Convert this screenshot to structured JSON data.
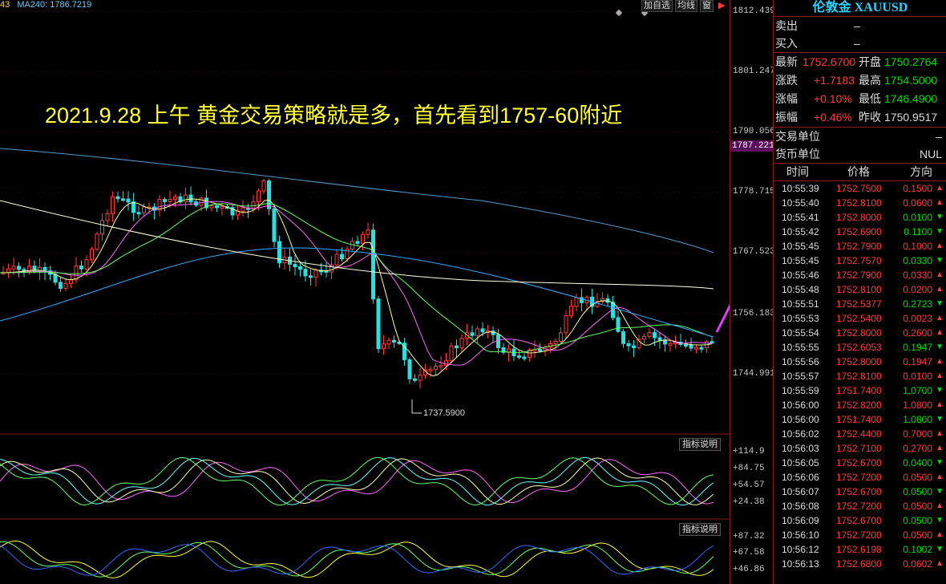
{
  "chart_header": {
    "ma_prefix": "43",
    "ma_label": "MA240: 1786.7219",
    "buttons": [
      "加自选",
      "均线",
      "窗"
    ]
  },
  "annotation_text": "2021.9.28 上午 黄金交易策略就是多，首先看到1757-60附近",
  "low_marker": "1737.5900",
  "price_axis": [
    "1812.439",
    "1801.247",
    "1790.056",
    "1787.221",
    "1778.715",
    "1767.523",
    "1756.183",
    "1744.991"
  ],
  "indicator1": {
    "button": "指标说明",
    "ticks": [
      "+114.9",
      "+84.75",
      "+54.57",
      "+24.38"
    ]
  },
  "indicator2": {
    "button": "指标说明",
    "ticks": [
      "+87.32",
      "+67.58",
      "+46.86"
    ]
  },
  "quote": {
    "title": "伦敦金 XAUUSD",
    "sell_label": "卖出",
    "sell_value": "–",
    "buy_label": "买入",
    "buy_value": "–",
    "stats": [
      {
        "l1": "最新",
        "v1": "1752.6700",
        "l2": "开盘",
        "v2": "1750.2764"
      },
      {
        "l1": "涨跌",
        "v1": "+1.7183",
        "l2": "最高",
        "v2": "1754.5000"
      },
      {
        "l1": "涨幅",
        "v1": "+0.10%",
        "l2": "最低",
        "v2": "1746.4900"
      },
      {
        "l1": "振幅",
        "v1": "+0.46%",
        "l2": "昨收",
        "v2": "1750.9517"
      }
    ],
    "trade_unit_label": "交易单位",
    "trade_unit_value": "–",
    "currency_label": "货币单位",
    "currency_value": "NUL",
    "tick_headers": [
      "时间",
      "价格",
      "方向"
    ],
    "ticks": [
      {
        "time": "10:55:39",
        "price": "1752.7500",
        "vol": "0.1500",
        "dir": "up"
      },
      {
        "time": "10:55:40",
        "price": "1752.8100",
        "vol": "0.0600",
        "dir": "up"
      },
      {
        "time": "10:55:41",
        "price": "1752.8000",
        "vol": "0.0100",
        "dir": "down"
      },
      {
        "time": "10:55:42",
        "price": "1752.6900",
        "vol": "0.1100",
        "dir": "down"
      },
      {
        "time": "10:55:45",
        "price": "1752.7900",
        "vol": "0.1000",
        "dir": "up"
      },
      {
        "time": "10:55:45",
        "price": "1752.7570",
        "vol": "0.0330",
        "dir": "down"
      },
      {
        "time": "10:55:46",
        "price": "1752.7900",
        "vol": "0.0330",
        "dir": "up"
      },
      {
        "time": "10:55:48",
        "price": "1752.8100",
        "vol": "0.0200",
        "dir": "up"
      },
      {
        "time": "10:55:51",
        "price": "1752.5377",
        "vol": "0.2723",
        "dir": "down"
      },
      {
        "time": "10:55:53",
        "price": "1752.5400",
        "vol": "0.0023",
        "dir": "up"
      },
      {
        "time": "10:55:54",
        "price": "1752.8000",
        "vol": "0.2600",
        "dir": "up"
      },
      {
        "time": "10:55:55",
        "price": "1752.6053",
        "vol": "0.1947",
        "dir": "down"
      },
      {
        "time": "10:55:56",
        "price": "1752.8000",
        "vol": "0.1947",
        "dir": "up"
      },
      {
        "time": "10:55:57",
        "price": "1752.8100",
        "vol": "0.0100",
        "dir": "up"
      },
      {
        "time": "10:55:59",
        "price": "1751.7400",
        "vol": "1.0700",
        "dir": "down"
      },
      {
        "time": "10:56:00",
        "price": "1752.8200",
        "vol": "1.0800",
        "dir": "up"
      },
      {
        "time": "10:56:00",
        "price": "1751.7400",
        "vol": "1.0800",
        "dir": "down"
      },
      {
        "time": "10:56:02",
        "price": "1752.4400",
        "vol": "0.7000",
        "dir": "up"
      },
      {
        "time": "10:56:03",
        "price": "1752.7100",
        "vol": "0.2700",
        "dir": "up"
      },
      {
        "time": "10:56:05",
        "price": "1752.6700",
        "vol": "0.0400",
        "dir": "down"
      },
      {
        "time": "10:56:06",
        "price": "1752.7200",
        "vol": "0.0500",
        "dir": "up"
      },
      {
        "time": "10:56:07",
        "price": "1752.6700",
        "vol": "0.0500",
        "dir": "down"
      },
      {
        "time": "10:56:08",
        "price": "1752.7200",
        "vol": "0.0500",
        "dir": "up"
      },
      {
        "time": "10:56:09",
        "price": "1752.6700",
        "vol": "0.0500",
        "dir": "down"
      },
      {
        "time": "10:56:10",
        "price": "1752.7200",
        "vol": "0.0500",
        "dir": "up"
      },
      {
        "time": "10:56:12",
        "price": "1752.6198",
        "vol": "0.1002",
        "dir": "down"
      },
      {
        "time": "10:56:13",
        "price": "1752.6800",
        "vol": "0.0602",
        "dir": "up"
      }
    ]
  },
  "colors": {
    "up": "#ff3b3b",
    "down": "#00e000",
    "accent": "#29d3ff",
    "grid": "#8b1a1a",
    "annotation": "#ffff33"
  }
}
